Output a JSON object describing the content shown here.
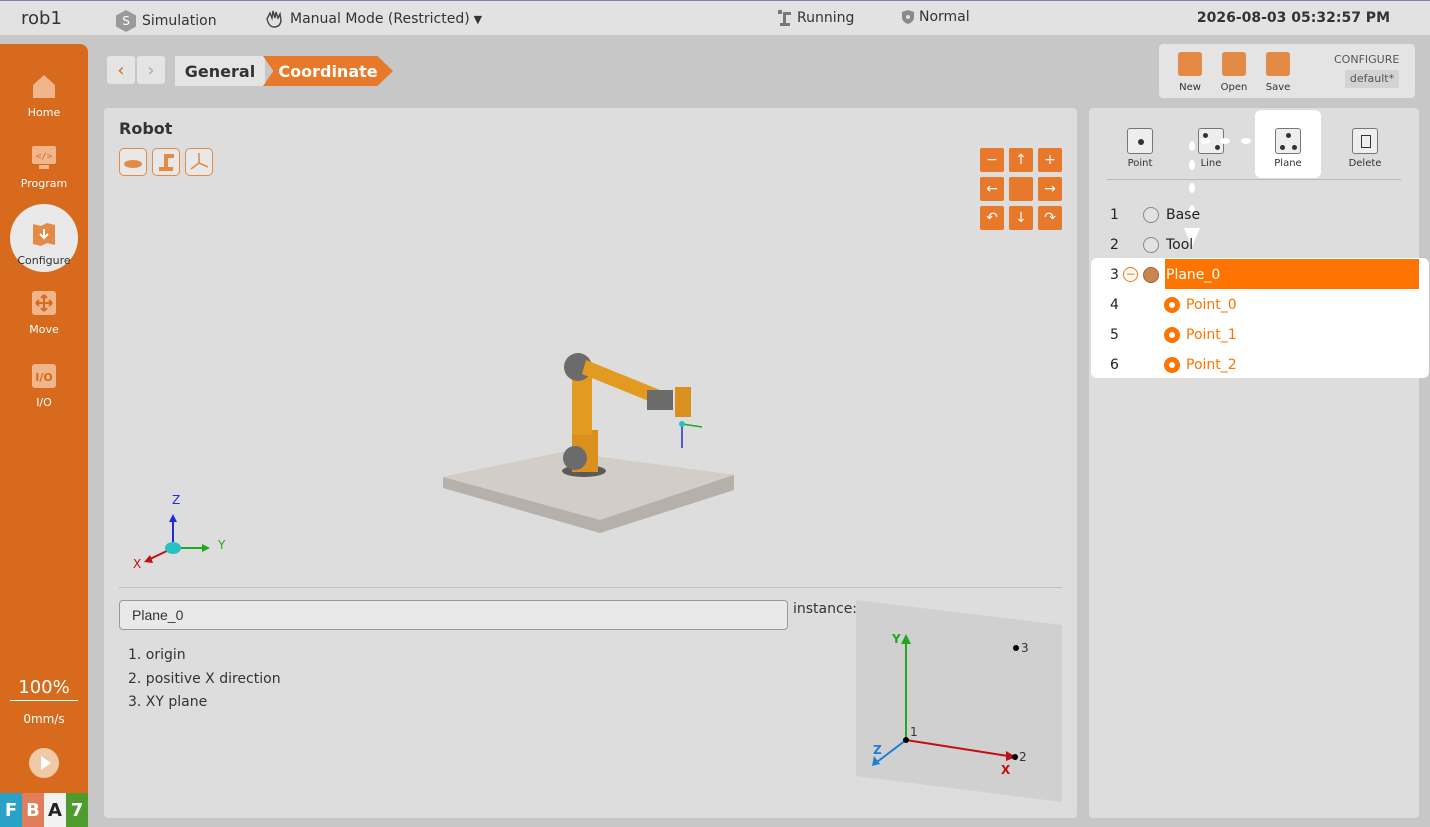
{
  "header": {
    "app_name": "rob1",
    "simulation_label": "Simulation",
    "mode_label": "Manual Mode (Restricted)",
    "running_label": "Running",
    "safety_label": "Normal",
    "datetime": "2026-08-03 05:32:57 PM"
  },
  "sidebar": {
    "items": [
      {
        "label": "Home",
        "icon": "home-icon"
      },
      {
        "label": "Program",
        "icon": "code-icon"
      },
      {
        "label": "Configure",
        "icon": "configure-icon",
        "active": true
      },
      {
        "label": "Move",
        "icon": "move-arrows-icon"
      },
      {
        "label": "I/O",
        "icon": "io-icon"
      }
    ],
    "speed_percent": "100%",
    "speed_mm": "0mm/s",
    "status_letters": [
      {
        "letter": "F",
        "color": "#2aa1c7"
      },
      {
        "letter": "B",
        "color": "#e07d5a"
      },
      {
        "letter": "A",
        "color": "#f2f2f2"
      },
      {
        "letter": "7",
        "color": "#4f9c2e"
      }
    ]
  },
  "breadcrumb": {
    "back": "‹",
    "forward": "›",
    "items": [
      "General",
      "Coordinate"
    ]
  },
  "file_toolbar": {
    "new_label": "New",
    "open_label": "Open",
    "save_label": "Save",
    "config_title": "CONFIGURE",
    "config_name": "default*"
  },
  "robot_view": {
    "title": "Robot",
    "axis_labels": {
      "x": "X",
      "y": "Y",
      "z": "Z"
    }
  },
  "plane": {
    "name_value": "Plane_0",
    "instance_label": "instance:",
    "steps": [
      "1. origin",
      "2. positive X direction",
      "3. XY plane"
    ],
    "diagram": {
      "y": "Y",
      "z": "Z",
      "x": "X",
      "p1": "1",
      "p2": "2",
      "p3": "3"
    }
  },
  "right_panel": {
    "tools": [
      {
        "label": "Point",
        "icon": "point-icon"
      },
      {
        "label": "Line",
        "icon": "line-icon"
      },
      {
        "label": "Plane",
        "icon": "plane-icon",
        "active": true
      },
      {
        "label": "Delete",
        "icon": "trash-icon"
      }
    ],
    "rows": [
      {
        "num": "1",
        "label": "Base"
      },
      {
        "num": "2",
        "label": "Tool"
      },
      {
        "num": "3",
        "label": "Plane_0",
        "selected": true
      },
      {
        "num": "4",
        "label": "Point_0"
      },
      {
        "num": "5",
        "label": "Point_1"
      },
      {
        "num": "6",
        "label": "Point_2"
      }
    ]
  },
  "colors": {
    "accent": "#d86a1e",
    "selection": "#ff7300"
  }
}
